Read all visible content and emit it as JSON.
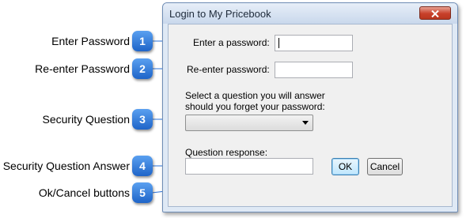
{
  "dialog": {
    "title": "Login to My Pricebook",
    "password_label": "Enter a password:",
    "password_value": "",
    "reenter_label": "Re-enter password:",
    "reenter_value": "",
    "question_prompt_line1": "Select a question you will answer",
    "question_prompt_line2": "should you forget your password:",
    "question_selected": "",
    "response_label": "Question response:",
    "response_value": "",
    "ok_label": "OK",
    "cancel_label": "Cancel"
  },
  "callouts": [
    {
      "number": "1",
      "label": "Enter Password"
    },
    {
      "number": "2",
      "label": "Re-enter Password"
    },
    {
      "number": "3",
      "label": "Security Question"
    },
    {
      "number": "4",
      "label": "Security Question Answer"
    },
    {
      "number": "5",
      "label": "Ok/Cancel buttons"
    }
  ],
  "colors": {
    "badge": "#2a72d8",
    "leader_line": "#2a72d8",
    "close_button": "#c8402a"
  },
  "icons": {
    "close": "close-icon",
    "dropdown": "chevron-down-icon"
  }
}
